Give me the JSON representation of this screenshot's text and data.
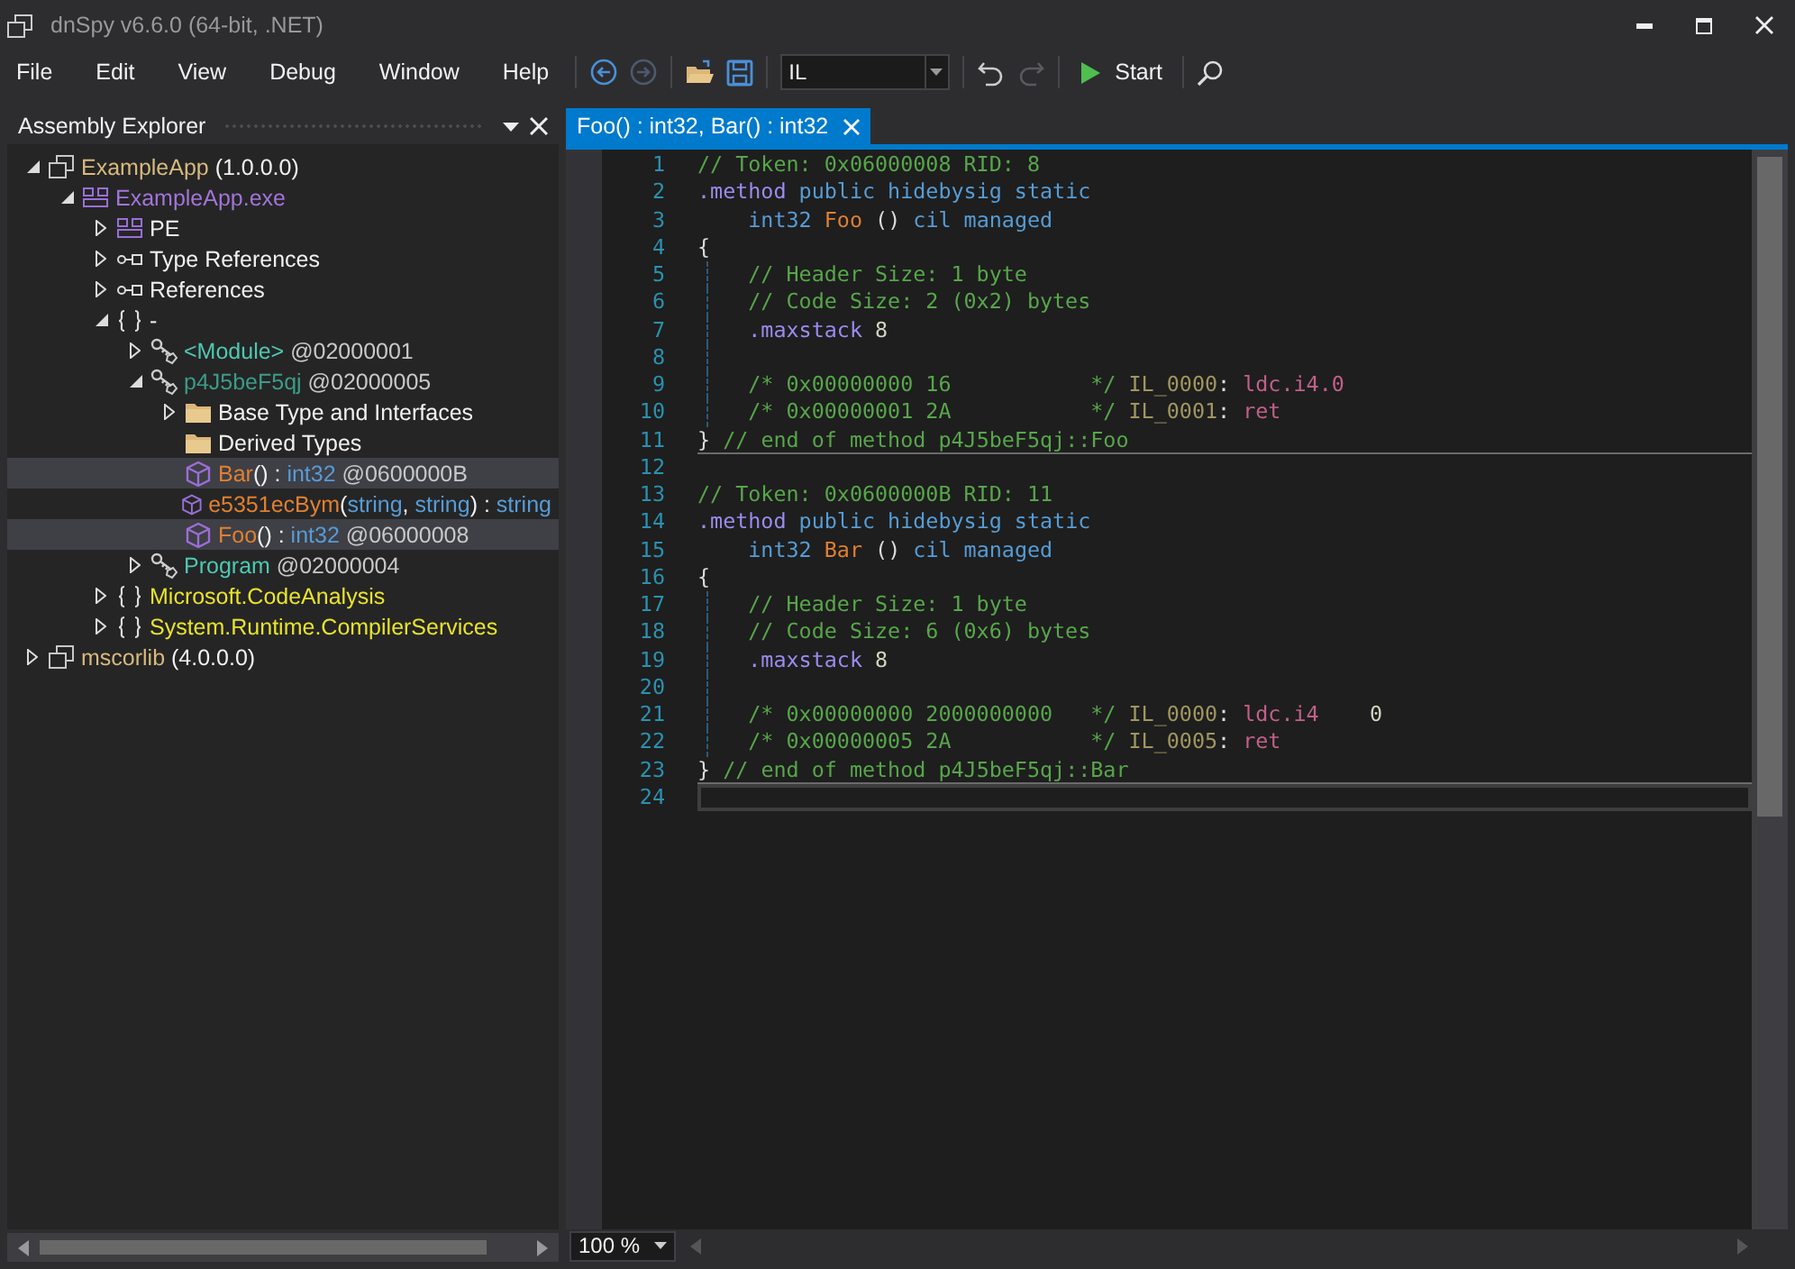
{
  "window": {
    "title": "dnSpy v6.6.0 (64-bit, .NET)"
  },
  "menu": [
    "File",
    "Edit",
    "View",
    "Debug",
    "Window",
    "Help"
  ],
  "toolbar": {
    "language": "IL",
    "start": "Start"
  },
  "explorer": {
    "title": "Assembly Explorer",
    "tree": [
      {
        "kind": "assembly",
        "expanded": true,
        "selected": false,
        "parts": [
          {
            "kind": "assembly",
            "text": "ExampleApp"
          },
          {
            "kind": "plain",
            "text": " (1.0.0.0)"
          }
        ],
        "children": [
          {
            "kind": "module",
            "expanded": true,
            "selected": false,
            "parts": [
              {
                "kind": "module",
                "text": "ExampleApp.exe"
              }
            ],
            "children": [
              {
                "kind": "module",
                "expanded": false,
                "selected": false,
                "parts": [
                  {
                    "kind": "plain",
                    "text": "PE"
                  }
                ]
              },
              {
                "kind": "reference",
                "expanded": false,
                "selected": false,
                "parts": [
                  {
                    "kind": "plain",
                    "text": "Type References"
                  }
                ]
              },
              {
                "kind": "reference",
                "expanded": false,
                "selected": false,
                "parts": [
                  {
                    "kind": "plain",
                    "text": "References"
                  }
                ]
              },
              {
                "kind": "namespace",
                "expanded": true,
                "selected": false,
                "parts": [
                  {
                    "kind": "plain",
                    "text": "-"
                  }
                ],
                "children": [
                  {
                    "kind": "class",
                    "expanded": false,
                    "selected": false,
                    "parts": [
                      {
                        "kind": "type",
                        "text": "<Module>"
                      },
                      {
                        "kind": "token",
                        "text": " @02000001"
                      }
                    ]
                  },
                  {
                    "kind": "class",
                    "expanded": true,
                    "selected": false,
                    "parts": [
                      {
                        "kind": "type-dim",
                        "text": "p4J5beF5qj"
                      },
                      {
                        "kind": "token",
                        "text": " @02000005"
                      }
                    ],
                    "children": [
                      {
                        "kind": "folder",
                        "expanded": false,
                        "selected": false,
                        "parts": [
                          {
                            "kind": "plain",
                            "text": "Base Type and Interfaces"
                          }
                        ]
                      },
                      {
                        "kind": "folder",
                        "selected": false,
                        "parts": [
                          {
                            "kind": "plain",
                            "text": "Derived Types"
                          }
                        ]
                      },
                      {
                        "kind": "method",
                        "selected": true,
                        "parts": [
                          {
                            "kind": "method",
                            "text": "Bar"
                          },
                          {
                            "kind": "plain",
                            "text": "() : "
                          },
                          {
                            "kind": "typeref",
                            "text": "int32"
                          },
                          {
                            "kind": "token",
                            "text": " @0600000B"
                          }
                        ]
                      },
                      {
                        "kind": "method",
                        "selected": false,
                        "parts": [
                          {
                            "kind": "method",
                            "text": "e5351ecBym"
                          },
                          {
                            "kind": "plain",
                            "text": "("
                          },
                          {
                            "kind": "typeref",
                            "text": "string"
                          },
                          {
                            "kind": "plain",
                            "text": ", "
                          },
                          {
                            "kind": "typeref",
                            "text": "string"
                          },
                          {
                            "kind": "plain",
                            "text": ") : "
                          },
                          {
                            "kind": "typeref",
                            "text": "string"
                          }
                        ]
                      },
                      {
                        "kind": "method",
                        "selected": true,
                        "parts": [
                          {
                            "kind": "method",
                            "text": "Foo"
                          },
                          {
                            "kind": "plain",
                            "text": "() : "
                          },
                          {
                            "kind": "typeref",
                            "text": "int32"
                          },
                          {
                            "kind": "token",
                            "text": " @06000008"
                          }
                        ]
                      }
                    ]
                  },
                  {
                    "kind": "class",
                    "expanded": false,
                    "selected": false,
                    "parts": [
                      {
                        "kind": "type",
                        "text": "Program"
                      },
                      {
                        "kind": "token",
                        "text": " @02000004"
                      }
                    ]
                  }
                ]
              },
              {
                "kind": "namespace",
                "expanded": false,
                "selected": false,
                "parts": [
                  {
                    "kind": "namespace",
                    "text": "Microsoft.CodeAnalysis"
                  }
                ]
              },
              {
                "kind": "namespace",
                "expanded": false,
                "selected": false,
                "parts": [
                  {
                    "kind": "namespace",
                    "text": "System.Runtime.CompilerServices"
                  }
                ]
              }
            ]
          }
        ]
      },
      {
        "kind": "assembly",
        "expanded": false,
        "selected": false,
        "parts": [
          {
            "kind": "assembly",
            "text": "mscorlib"
          },
          {
            "kind": "plain",
            "text": " (4.0.0.0)"
          }
        ]
      }
    ]
  },
  "editor": {
    "tab": "Foo() : int32, Bar() : int32",
    "zoom": "100 %",
    "lines": [
      {
        "number": "1",
        "kind": "code",
        "tokens": [
          {
            "kind": "comment",
            "text": "// Token: 0x06000008 RID: 8"
          }
        ]
      },
      {
        "number": "2",
        "kind": "code",
        "tokens": [
          {
            "kind": "directive",
            "text": ".method"
          },
          {
            "kind": "keyword",
            "text": " public hidebysig static"
          }
        ]
      },
      {
        "number": "3",
        "kind": "code",
        "tokens": [
          {
            "kind": "keyword",
            "text": "    int32"
          },
          {
            "kind": "name",
            "text": " Foo"
          },
          {
            "kind": "plain",
            "text": " () "
          },
          {
            "kind": "keyword",
            "text": "cil managed"
          }
        ]
      },
      {
        "number": "4",
        "kind": "code",
        "tokens": [
          {
            "kind": "plain",
            "text": "{"
          }
        ]
      },
      {
        "number": "5",
        "kind": "body",
        "tokens": [
          {
            "kind": "comment",
            "text": "    // Header Size: 1 byte"
          }
        ]
      },
      {
        "number": "6",
        "kind": "body",
        "tokens": [
          {
            "kind": "comment",
            "text": "    // Code Size: 2 (0x2) bytes"
          }
        ]
      },
      {
        "number": "7",
        "kind": "body",
        "tokens": [
          {
            "kind": "directive",
            "text": "    .maxstack"
          },
          {
            "kind": "number",
            "text": " 8"
          }
        ]
      },
      {
        "number": "8",
        "kind": "body"
      },
      {
        "number": "9",
        "kind": "body",
        "tokens": [
          {
            "kind": "comment",
            "text": "    /* 0x00000000 16           */"
          },
          {
            "kind": "label",
            "text": " IL_0000"
          },
          {
            "kind": "plain",
            "text": ": "
          },
          {
            "kind": "opcode",
            "text": "ldc.i4.0"
          }
        ]
      },
      {
        "number": "10",
        "kind": "body",
        "tokens": [
          {
            "kind": "comment",
            "text": "    /* 0x00000001 2A           */"
          },
          {
            "kind": "label",
            "text": " IL_0001"
          },
          {
            "kind": "plain",
            "text": ": "
          },
          {
            "kind": "opcode",
            "text": "ret"
          }
        ]
      },
      {
        "number": "11",
        "kind": "end",
        "tokens": [
          {
            "kind": "plain",
            "text": "}"
          },
          {
            "kind": "comment",
            "text": " // end of method p4J5beF5qj::Foo"
          }
        ]
      },
      {
        "number": "12",
        "kind": "code"
      },
      {
        "number": "13",
        "kind": "code",
        "tokens": [
          {
            "kind": "comment",
            "text": "// Token: 0x0600000B RID: 11"
          }
        ]
      },
      {
        "number": "14",
        "kind": "code",
        "tokens": [
          {
            "kind": "directive",
            "text": ".method"
          },
          {
            "kind": "keyword",
            "text": " public hidebysig static"
          }
        ]
      },
      {
        "number": "15",
        "kind": "code",
        "tokens": [
          {
            "kind": "keyword",
            "text": "    int32"
          },
          {
            "kind": "name",
            "text": " Bar"
          },
          {
            "kind": "plain",
            "text": " () "
          },
          {
            "kind": "keyword",
            "text": "cil managed"
          }
        ]
      },
      {
        "number": "16",
        "kind": "code",
        "tokens": [
          {
            "kind": "plain",
            "text": "{"
          }
        ]
      },
      {
        "number": "17",
        "kind": "body",
        "tokens": [
          {
            "kind": "comment",
            "text": "    // Header Size: 1 byte"
          }
        ]
      },
      {
        "number": "18",
        "kind": "body",
        "tokens": [
          {
            "kind": "comment",
            "text": "    // Code Size: 6 (0x6) bytes"
          }
        ]
      },
      {
        "number": "19",
        "kind": "body",
        "tokens": [
          {
            "kind": "directive",
            "text": "    .maxstack"
          },
          {
            "kind": "number",
            "text": " 8"
          }
        ]
      },
      {
        "number": "20",
        "kind": "body"
      },
      {
        "number": "21",
        "kind": "body",
        "tokens": [
          {
            "kind": "comment",
            "text": "    /* 0x00000000 2000000000   */"
          },
          {
            "kind": "label",
            "text": " IL_0000"
          },
          {
            "kind": "plain",
            "text": ": "
          },
          {
            "kind": "opcode",
            "text": "ldc.i4"
          },
          {
            "kind": "number",
            "text": "    0"
          }
        ]
      },
      {
        "number": "22",
        "kind": "body",
        "tokens": [
          {
            "kind": "comment",
            "text": "    /* 0x00000005 2A           */"
          },
          {
            "kind": "label",
            "text": " IL_0005"
          },
          {
            "kind": "plain",
            "text": ": "
          },
          {
            "kind": "opcode",
            "text": "ret"
          }
        ]
      },
      {
        "number": "23",
        "kind": "end",
        "tokens": [
          {
            "kind": "plain",
            "text": "}"
          },
          {
            "kind": "comment",
            "text": " // end of method p4J5beF5qj::Bar"
          }
        ]
      },
      {
        "number": "24",
        "kind": "current"
      }
    ]
  }
}
